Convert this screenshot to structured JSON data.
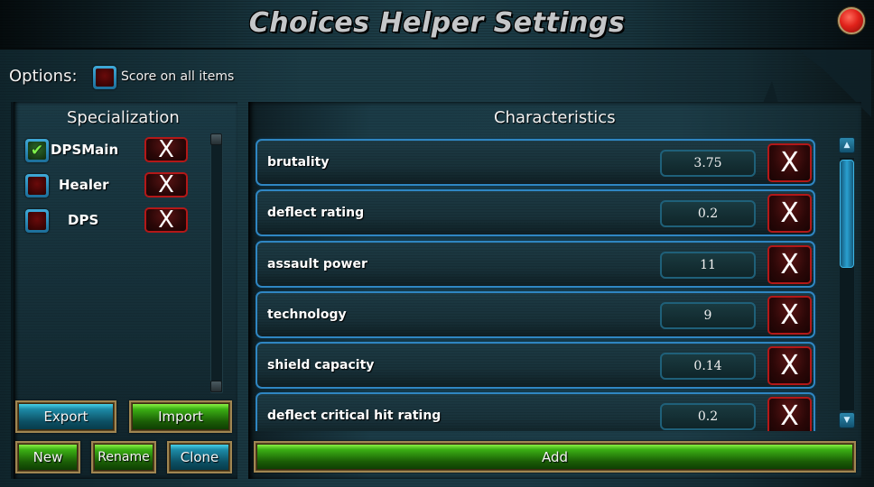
{
  "window": {
    "title": "Choices Helper Settings",
    "close_icon": "red-orb-close-icon"
  },
  "options": {
    "label": "Options:",
    "score_on_all_items": {
      "label": "Score on all items",
      "checked": false
    }
  },
  "specialization": {
    "heading": "Specialization",
    "items": [
      {
        "name": "DPSMain",
        "checked": true,
        "remove_label": "X"
      },
      {
        "name": "Healer",
        "checked": false,
        "remove_label": "X"
      },
      {
        "name": "DPS",
        "checked": false,
        "remove_label": "X"
      }
    ],
    "buttons": {
      "export": "Export",
      "import": "Import",
      "new": "New",
      "rename": "Rename",
      "clone": "Clone"
    }
  },
  "characteristics": {
    "heading": "Characteristics",
    "rows": [
      {
        "name": "brutality",
        "value": "3.75",
        "remove_label": "X"
      },
      {
        "name": "deflect rating",
        "value": "0.2",
        "remove_label": "X"
      },
      {
        "name": "assault power",
        "value": "11",
        "remove_label": "X"
      },
      {
        "name": "technology",
        "value": "9",
        "remove_label": "X"
      },
      {
        "name": "shield capacity",
        "value": "0.14",
        "remove_label": "X"
      },
      {
        "name": "deflect critical hit rating",
        "value": "0.2",
        "remove_label": "X"
      }
    ],
    "add_label": "Add",
    "scroll": {
      "up_glyph": "▲",
      "down_glyph": "▼"
    }
  },
  "colors": {
    "accent_blue": "#2f86c2",
    "remove_red": "#b31818",
    "button_green": "#3bb014",
    "button_blue": "#1d8ba7",
    "gold_frame": "#a08652"
  }
}
